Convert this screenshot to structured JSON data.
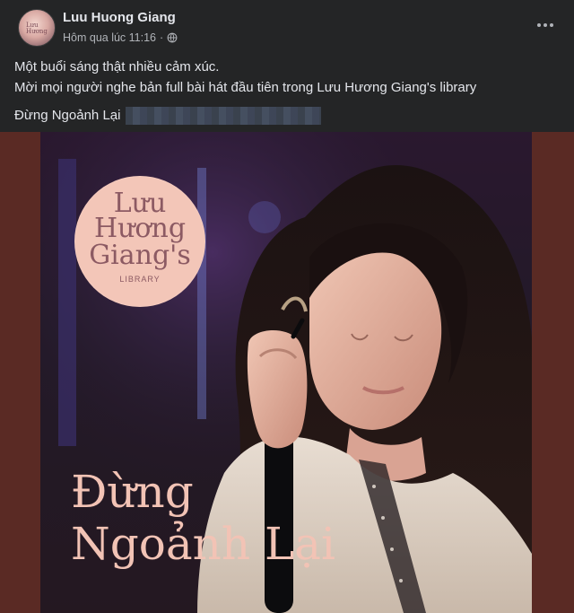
{
  "post": {
    "author": "Luu Huong Giang",
    "timestamp": "Hôm qua lúc 11:16",
    "separator": "·",
    "privacy_icon": "globe-icon",
    "more_icon": "more-horizontal-icon",
    "text_lines": [
      "Một buổi sáng thật nhiều cảm xúc.",
      "Mời mọi người nghe bản full  bài hát đầu tiên trong Lưu Hương Giang's library"
    ],
    "song_label": "Đừng Ngoảnh Lại"
  },
  "avatar": {
    "mini_text_1": "Lưu",
    "mini_text_2": "Hương"
  },
  "cover": {
    "logo_lines": [
      "Lưu",
      "Hương",
      "Giang's"
    ],
    "logo_sub": "LIBRARY",
    "title_line1": "Đừng",
    "title_line2": "Ngoảnh Lại"
  },
  "colors": {
    "background": "#242526",
    "text": "#e4e6eb",
    "secondary": "#b0b3b8",
    "media_border": "#5a2a24",
    "title_color": "#f2c3b5",
    "logo_circle": "#f3c6b8"
  }
}
